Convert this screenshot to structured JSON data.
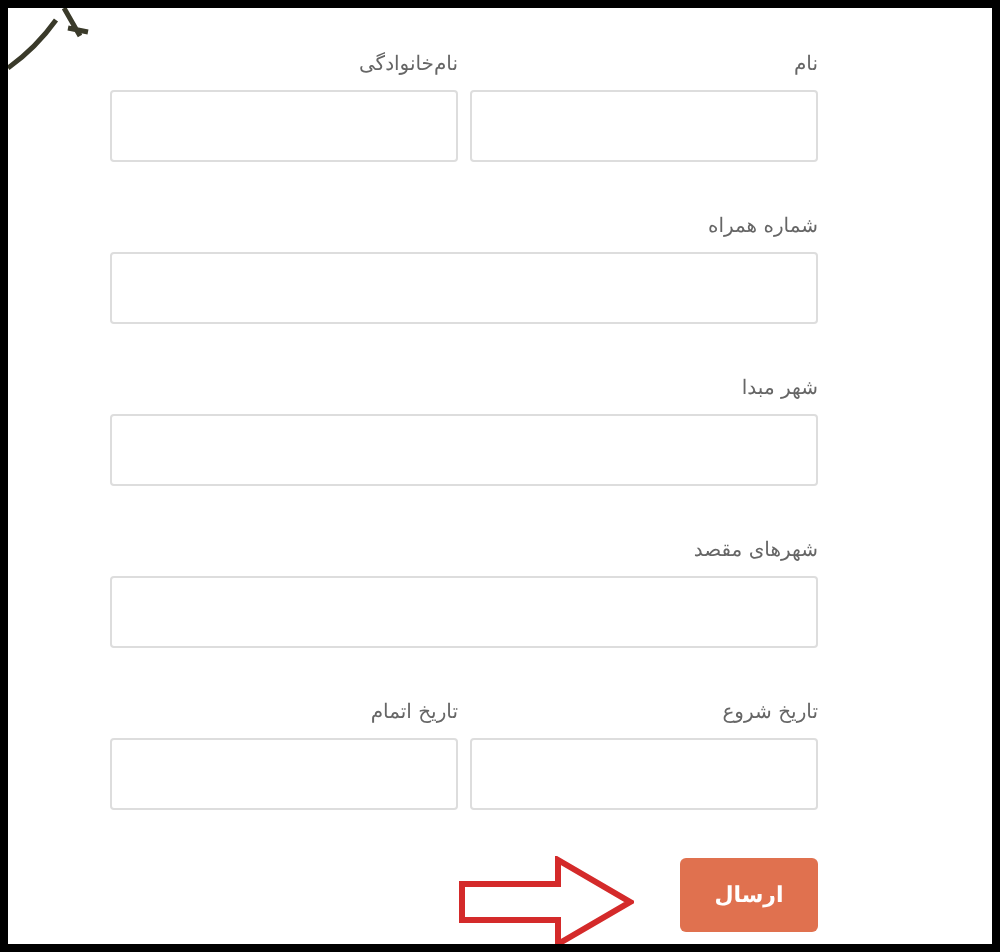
{
  "form": {
    "rows": [
      [
        {
          "label": "نام"
        },
        {
          "label": "نام‌خانوادگی"
        }
      ],
      [
        {
          "label": "شماره همراه"
        }
      ],
      [
        {
          "label": "شهر مبدا"
        }
      ],
      [
        {
          "label": "شهرهای مقصد"
        }
      ],
      [
        {
          "label": "تاریخ شروع"
        },
        {
          "label": "تاریخ اتمام"
        }
      ]
    ],
    "submit": "ارسال"
  }
}
